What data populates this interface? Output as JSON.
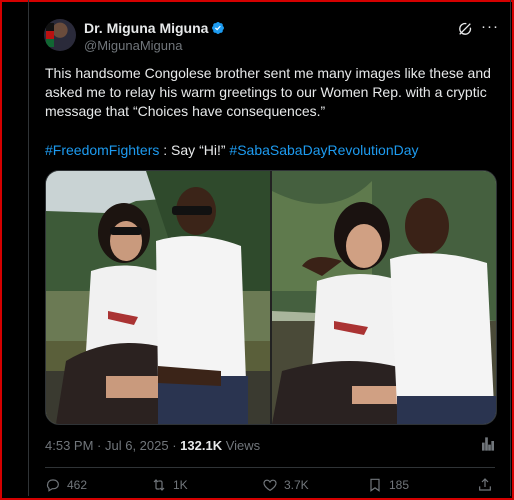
{
  "author": {
    "name": "Dr. Miguna Miguna",
    "handle": "@MigunaMiguna"
  },
  "tweet": {
    "text": "This handsome Congolese brother sent me many images like these and asked me to relay his warm greetings to our Women Rep. with a cryptic message that “Choices have consequences.”",
    "tag1": "#FreedomFighters",
    "mid_text": " : Say “Hi!” ",
    "tag2": "#SabaSabaDayRevolutionDay"
  },
  "meta": {
    "time": "4:53 PM",
    "sep1": " · ",
    "date": "Jul 6, 2025",
    "sep2": " · ",
    "views": "132.1K",
    "views_label": " Views"
  },
  "actions": {
    "replies": "462",
    "reposts": "1K",
    "likes": "3.7K",
    "bookmarks": "185"
  },
  "colors": {
    "accent": "#1d9bf0",
    "frame": "#d40000"
  }
}
